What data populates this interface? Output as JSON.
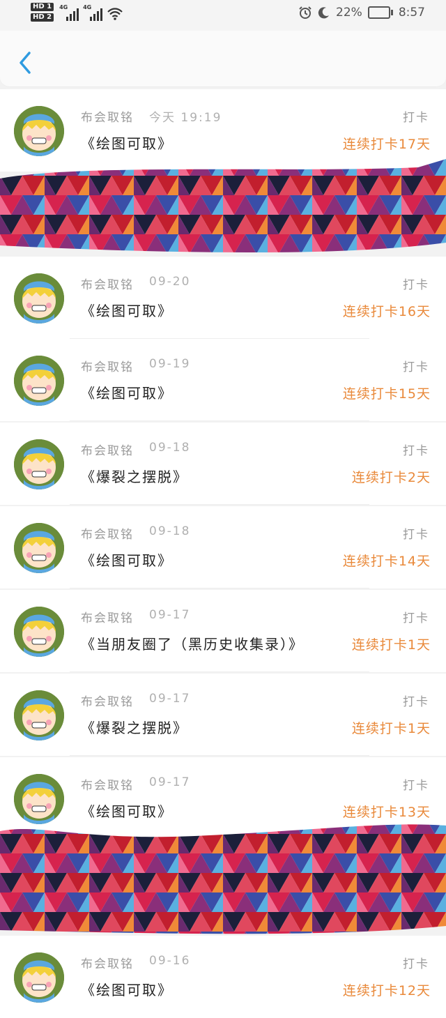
{
  "status_bar": {
    "hd1": "HD 1",
    "hd2": "HD 2",
    "net1": "4G",
    "net2": "4G",
    "battery_percent": "22%",
    "time": "8:57"
  },
  "nav": {
    "back_icon": "chevron-left-icon",
    "accent": "#2f9be0"
  },
  "streak_color": "#e9893a",
  "entries": [
    {
      "name": "布会取铭",
      "date": "今天 19:19",
      "title": "《绘图可取》",
      "type": "打卡",
      "streak": "连续打卡17天"
    },
    {
      "name": "布会取铭",
      "date": "09-20",
      "title": "《绘图可取》",
      "type": "打卡",
      "streak": "连续打卡16天"
    },
    {
      "name": "布会取铭",
      "date": "09-19",
      "title": "《绘图可取》",
      "type": "打卡",
      "streak": "连续打卡15天"
    },
    {
      "name": "布会取铭",
      "date": "09-18",
      "title": "《爆裂之摆脱》",
      "type": "打卡",
      "streak": "连续打卡2天"
    },
    {
      "name": "布会取铭",
      "date": "09-18",
      "title": "《绘图可取》",
      "type": "打卡",
      "streak": "连续打卡14天"
    },
    {
      "name": "布会取铭",
      "date": "09-17",
      "title": "《当朋友圈了（黑历史收集录）》",
      "type": "打卡",
      "streak": "连续打卡1天"
    },
    {
      "name": "布会取铭",
      "date": "09-17",
      "title": "《爆裂之摆脱》",
      "type": "打卡",
      "streak": "连续打卡1天"
    },
    {
      "name": "布会取铭",
      "date": "09-17",
      "title": "《绘图可取》",
      "type": "打卡",
      "streak": "连续打卡13天"
    },
    {
      "name": "布会取铭",
      "date": "09-16",
      "title": "《绘图可取》",
      "type": "打卡",
      "streak": "连续打卡12天"
    }
  ]
}
